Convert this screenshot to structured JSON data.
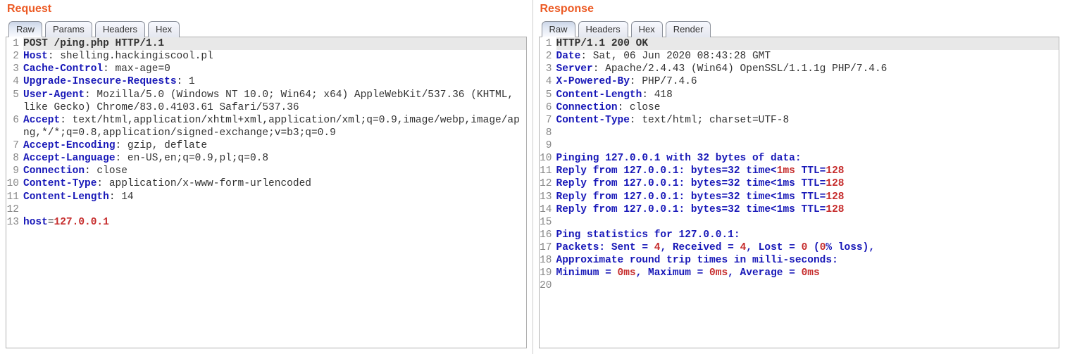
{
  "request": {
    "title": "Request",
    "tabs": [
      "Raw",
      "Params",
      "Headers",
      "Hex"
    ],
    "activeTab": 0,
    "lines": [
      [
        {
          "t": "POST /ping.php HTTP/1.1",
          "cls": "bold plain"
        }
      ],
      [
        {
          "t": "Host",
          "cls": "hn"
        },
        {
          "t": ": shelling.hackingiscool.pl",
          "cls": "hv"
        }
      ],
      [
        {
          "t": "Cache-Control",
          "cls": "hn"
        },
        {
          "t": ": max-age=0",
          "cls": "hv"
        }
      ],
      [
        {
          "t": "Upgrade-Insecure-Requests",
          "cls": "hn"
        },
        {
          "t": ": 1",
          "cls": "hv"
        }
      ],
      [
        {
          "t": "User-Agent",
          "cls": "hn"
        },
        {
          "t": ": Mozilla/5.0 (Windows NT 10.0; Win64; x64) AppleWebKit/537.36 (KHTML, like Gecko) Chrome/83.0.4103.61 Safari/537.36",
          "cls": "hv"
        }
      ],
      [
        {
          "t": "Accept",
          "cls": "hn"
        },
        {
          "t": ": text/html,application/xhtml+xml,application/xml;q=0.9,image/webp,image/apng,*/*;q=0.8,application/signed-exchange;v=b3;q=0.9",
          "cls": "hv"
        }
      ],
      [
        {
          "t": "Accept-Encoding",
          "cls": "hn"
        },
        {
          "t": ": gzip, deflate",
          "cls": "hv"
        }
      ],
      [
        {
          "t": "Accept-Language",
          "cls": "hn"
        },
        {
          "t": ": en-US,en;q=0.9,pl;q=0.8",
          "cls": "hv"
        }
      ],
      [
        {
          "t": "Connection",
          "cls": "hn"
        },
        {
          "t": ": close",
          "cls": "hv"
        }
      ],
      [
        {
          "t": "Content-Type",
          "cls": "hn"
        },
        {
          "t": ": application/x-www-form-urlencoded",
          "cls": "hv"
        }
      ],
      [
        {
          "t": "Content-Length",
          "cls": "hn"
        },
        {
          "t": ": 14",
          "cls": "hv"
        }
      ],
      [
        {
          "t": "",
          "cls": "hv"
        }
      ],
      [
        {
          "t": "host",
          "cls": "hn"
        },
        {
          "t": "=",
          "cls": "hv"
        },
        {
          "t": "127.0.0.1",
          "cls": "num"
        }
      ]
    ]
  },
  "response": {
    "title": "Response",
    "tabs": [
      "Raw",
      "Headers",
      "Hex",
      "Render"
    ],
    "activeTab": 0,
    "lines": [
      [
        {
          "t": "HTTP/1.1 200 OK",
          "cls": "bold plain"
        }
      ],
      [
        {
          "t": "Date",
          "cls": "hn"
        },
        {
          "t": ": Sat, 06 Jun 2020 08:43:28 GMT",
          "cls": "hv"
        }
      ],
      [
        {
          "t": "Server",
          "cls": "hn"
        },
        {
          "t": ": Apache/2.4.43 (Win64) OpenSSL/1.1.1g PHP/7.4.6",
          "cls": "hv"
        }
      ],
      [
        {
          "t": "X-Powered-By",
          "cls": "hn"
        },
        {
          "t": ": PHP/7.4.6",
          "cls": "hv"
        }
      ],
      [
        {
          "t": "Content-Length",
          "cls": "hn"
        },
        {
          "t": ": 418",
          "cls": "hv"
        }
      ],
      [
        {
          "t": "Connection",
          "cls": "hn"
        },
        {
          "t": ": close",
          "cls": "hv"
        }
      ],
      [
        {
          "t": "Content-Type",
          "cls": "hn"
        },
        {
          "t": ": text/html; charset=UTF-8",
          "cls": "hv"
        }
      ],
      [
        {
          "t": "",
          "cls": "hv"
        }
      ],
      [
        {
          "t": "",
          "cls": "hv"
        }
      ],
      [
        {
          "t": "Pinging 127.0.0.1 with 32 bytes of data:",
          "cls": "hn"
        }
      ],
      [
        {
          "t": "Reply from 127.0.0.1: bytes=32 time<",
          "cls": "hn"
        },
        {
          "t": "1ms",
          "cls": "num"
        },
        {
          "t": " TTL=",
          "cls": "hn"
        },
        {
          "t": "128",
          "cls": "num"
        }
      ],
      [
        {
          "t": "Reply from 127.0.0.1: bytes=32 time<1ms TTL=",
          "cls": "hn"
        },
        {
          "t": "128",
          "cls": "num"
        }
      ],
      [
        {
          "t": "Reply from 127.0.0.1: bytes=32 time<1ms TTL=",
          "cls": "hn"
        },
        {
          "t": "128",
          "cls": "num"
        }
      ],
      [
        {
          "t": "Reply from 127.0.0.1: bytes=32 time<1ms TTL=",
          "cls": "hn"
        },
        {
          "t": "128",
          "cls": "num"
        }
      ],
      [
        {
          "t": "",
          "cls": "hv"
        }
      ],
      [
        {
          "t": "Ping statistics for 127.0.0.1:",
          "cls": "hn"
        }
      ],
      [
        {
          "t": "Packets: Sent = ",
          "cls": "hn"
        },
        {
          "t": "4",
          "cls": "num"
        },
        {
          "t": ", Received = ",
          "cls": "hn"
        },
        {
          "t": "4",
          "cls": "num"
        },
        {
          "t": ", Lost = ",
          "cls": "hn"
        },
        {
          "t": "0",
          "cls": "num"
        },
        {
          "t": " (",
          "cls": "hn"
        },
        {
          "t": "0",
          "cls": "num"
        },
        {
          "t": "% loss),",
          "cls": "hn"
        }
      ],
      [
        {
          "t": "Approximate round trip times in milli-seconds:",
          "cls": "hn"
        }
      ],
      [
        {
          "t": "Minimum = ",
          "cls": "hn"
        },
        {
          "t": "0ms",
          "cls": "num"
        },
        {
          "t": ", Maximum = ",
          "cls": "hn"
        },
        {
          "t": "0ms",
          "cls": "num"
        },
        {
          "t": ", Average = ",
          "cls": "hn"
        },
        {
          "t": "0ms",
          "cls": "num"
        }
      ],
      [
        {
          "t": "",
          "cls": "hv"
        }
      ]
    ]
  }
}
